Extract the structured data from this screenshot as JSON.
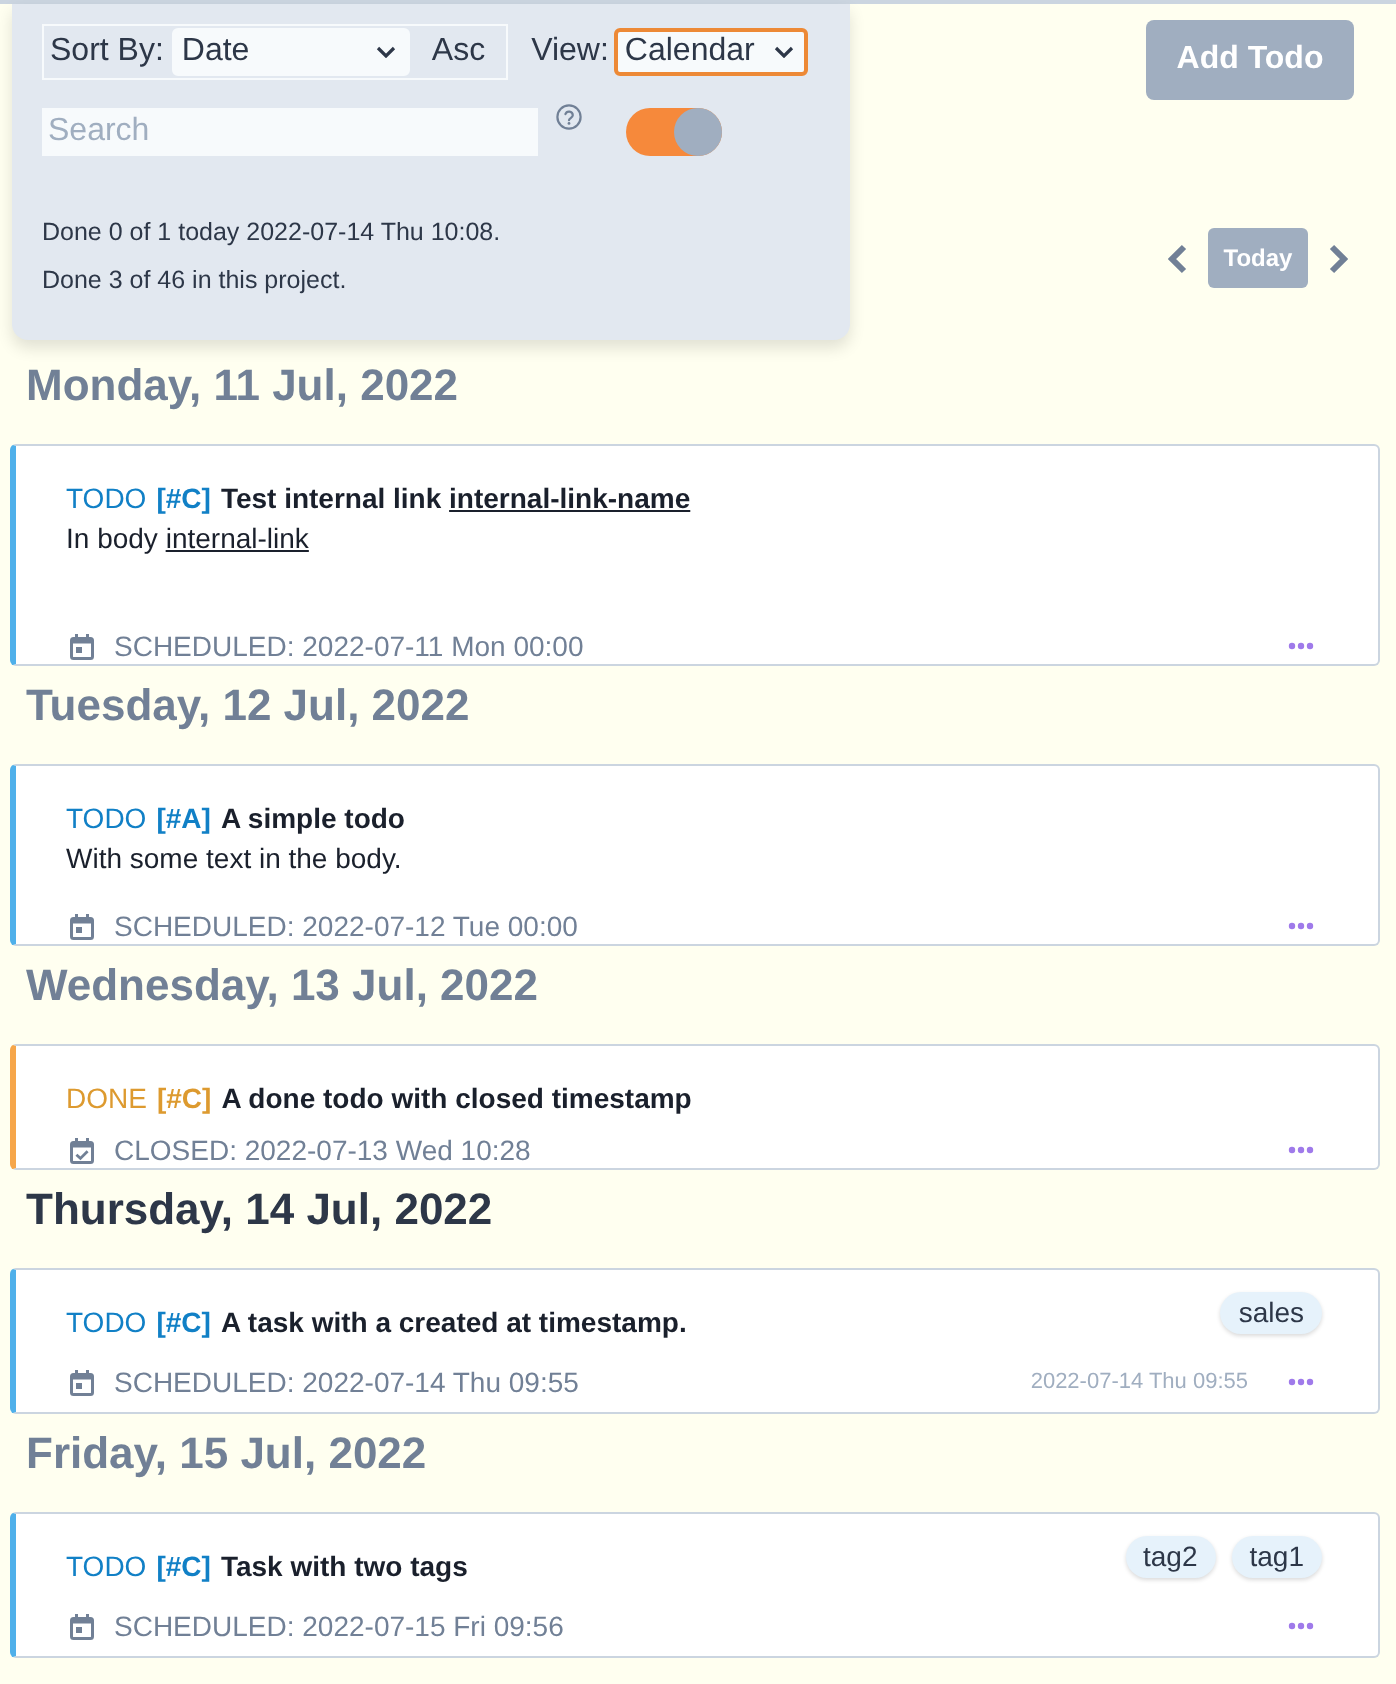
{
  "controls": {
    "sort": {
      "label": "Sort By:",
      "value": "Date",
      "focused": false,
      "direction": "Asc"
    },
    "view": {
      "label": "View:",
      "value": "Calendar",
      "focused": true
    },
    "search": {
      "placeholder": "Search"
    },
    "toggle": {
      "on": true
    }
  },
  "stats": [
    "Done 0 of 1 today 2022-07-14 Thu 10:08.",
    "Done 3 of 46 in this project."
  ],
  "add_button": "Add Todo",
  "nav": {
    "today_button": "Today"
  },
  "days": [
    {
      "heading": "Monday, 11 Jul, 2022",
      "today": false,
      "todos": [
        {
          "keyword": {
            "kind": "todo",
            "text": "TODO"
          },
          "priority": "[#C]",
          "title": [
            {
              "kind": "text",
              "text": "Test internal link"
            },
            {
              "kind": "link",
              "text": "internal-link-name"
            }
          ],
          "body": [
            {
              "kind": "text",
              "text": "In body"
            },
            {
              "kind": "link",
              "text": "internal-link"
            }
          ],
          "body_blank_line": true,
          "timestamp": {
            "kind": "scheduled",
            "text": "SCHEDULED: 2022-07-11 Mon 00:00"
          }
        }
      ]
    },
    {
      "heading": "Tuesday, 12 Jul, 2022",
      "today": false,
      "todos": [
        {
          "keyword": {
            "kind": "todo",
            "text": "TODO"
          },
          "priority": "[#A]",
          "title": [
            {
              "kind": "text",
              "text": "A simple todo"
            }
          ],
          "body": [
            {
              "kind": "text",
              "text": "With some text in the body."
            }
          ],
          "timestamp": {
            "kind": "scheduled",
            "text": "SCHEDULED: 2022-07-12 Tue 00:00"
          }
        }
      ]
    },
    {
      "heading": "Wednesday, 13 Jul, 2022",
      "today": false,
      "todos": [
        {
          "keyword": {
            "kind": "done",
            "text": "DONE"
          },
          "priority": "[#C]",
          "title": [
            {
              "kind": "text",
              "text": "A done todo with closed timestamp"
            }
          ],
          "timestamp": {
            "kind": "closed",
            "text": "CLOSED: 2022-07-13 Wed 10:28"
          }
        }
      ]
    },
    {
      "heading": "Thursday, 14 Jul, 2022",
      "today": true,
      "todos": [
        {
          "keyword": {
            "kind": "todo",
            "text": "TODO"
          },
          "priority": "[#C]",
          "title": [
            {
              "kind": "text",
              "text": "A task with a created at timestamp."
            }
          ],
          "tags": [
            "sales"
          ],
          "timestamp": {
            "kind": "scheduled",
            "text": "SCHEDULED: 2022-07-14 Thu 09:55"
          },
          "created": "2022-07-14 Thu 09:55"
        }
      ]
    },
    {
      "heading": "Friday, 15 Jul, 2022",
      "today": false,
      "todos": [
        {
          "keyword": {
            "kind": "todo",
            "text": "TODO"
          },
          "priority": "[#C]",
          "title": [
            {
              "kind": "text",
              "text": "Task with two tags"
            }
          ],
          "tags": [
            "tag2",
            "tag1"
          ],
          "timestamp": {
            "kind": "scheduled",
            "text": "SCHEDULED: 2022-07-15 Fri 09:56"
          }
        }
      ]
    }
  ]
}
